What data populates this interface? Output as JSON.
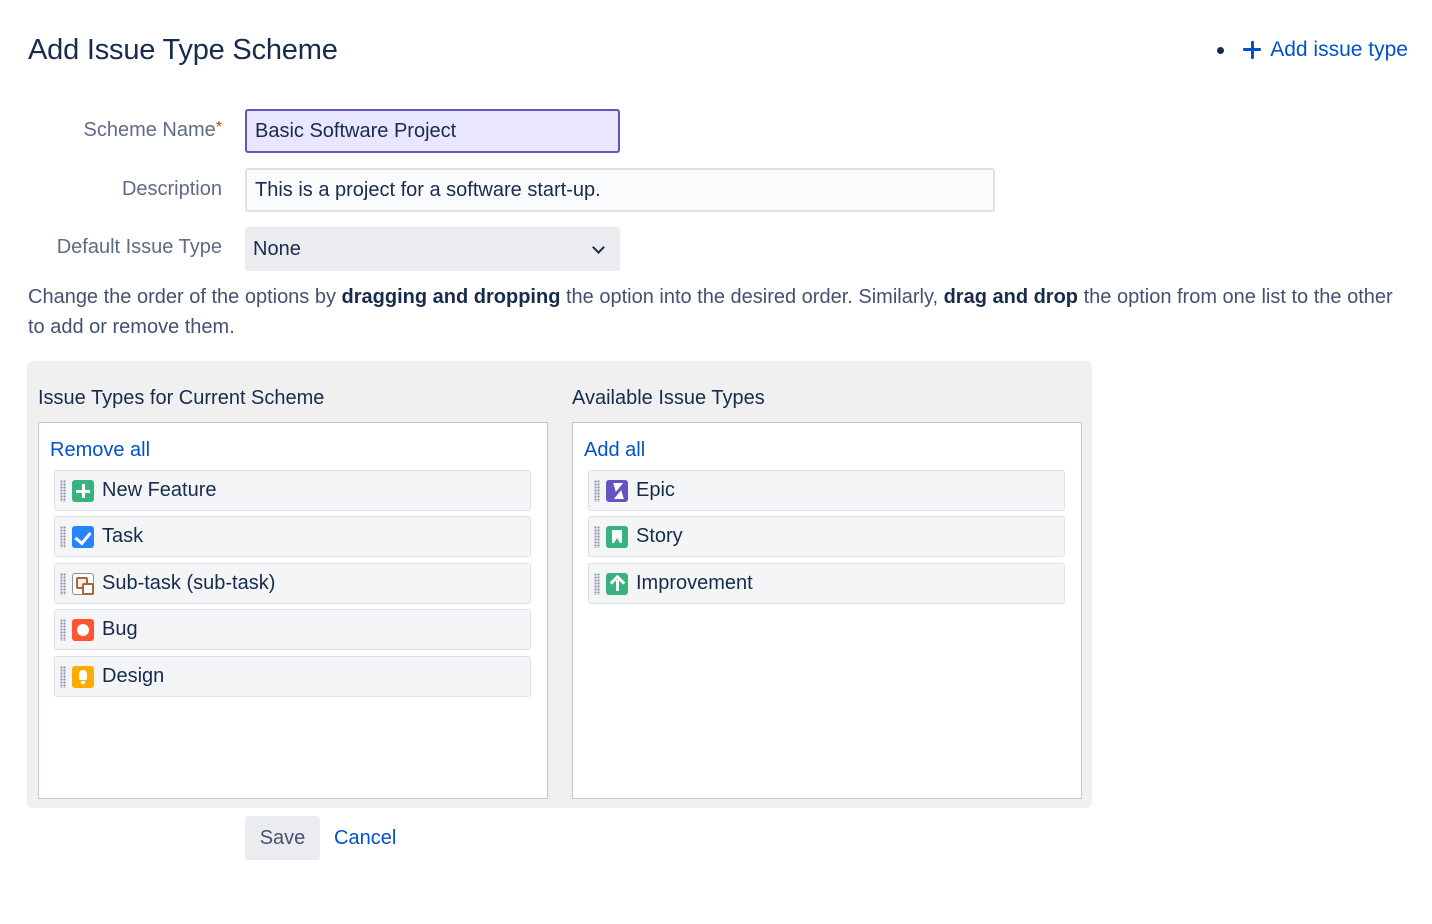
{
  "page": {
    "title": "Add Issue Type Scheme",
    "add_issue_type_label": "Add issue type"
  },
  "form": {
    "scheme_name_label": "Scheme Name",
    "required_marker": "*",
    "scheme_name_value": "Basic Software Project",
    "description_label": "Description",
    "description_value": "This is a project for a software start-up.",
    "default_issue_type_label": "Default Issue Type",
    "default_issue_type_value": "None"
  },
  "instructions": {
    "part1": "Change the order of the options by ",
    "bold1": "dragging and dropping",
    "part2": " the option into the desired order. Similarly, ",
    "bold2": "drag and drop",
    "part3": " the option from one list to the other to add or remove them."
  },
  "current_scheme": {
    "heading": "Issue Types for Current Scheme",
    "action_label": "Remove all",
    "items": [
      {
        "label": "New Feature",
        "icon": "new-feature-icon"
      },
      {
        "label": "Task",
        "icon": "task-icon"
      },
      {
        "label": "Sub-task (sub-task)",
        "icon": "subtask-icon"
      },
      {
        "label": "Bug",
        "icon": "bug-icon"
      },
      {
        "label": "Design",
        "icon": "lightbulb-icon"
      }
    ]
  },
  "available": {
    "heading": "Available Issue Types",
    "action_label": "Add all",
    "items": [
      {
        "label": "Epic",
        "icon": "epic-icon"
      },
      {
        "label": "Story",
        "icon": "story-icon"
      },
      {
        "label": "Improvement",
        "icon": "improvement-icon"
      }
    ]
  },
  "actions": {
    "save_label": "Save",
    "cancel_label": "Cancel"
  },
  "colors": {
    "link": "#0052cc",
    "focused_border": "#6554c0",
    "focused_fill": "#e9e6ff",
    "required": "#de350b"
  }
}
